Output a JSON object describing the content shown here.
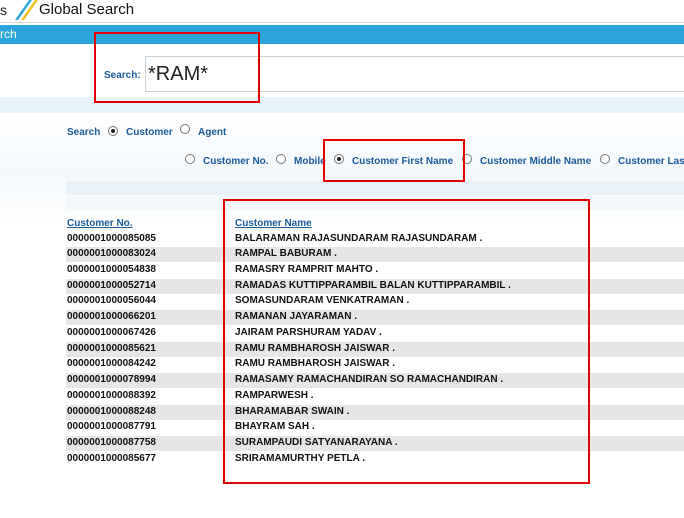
{
  "app": {
    "tab_fragment": "s",
    "title": "Global Search",
    "bar_label": "rch",
    "colors": {
      "brand_blue": "#2aa6dc",
      "label_blue": "#1a5a9a",
      "highlight_red": "#e00000"
    }
  },
  "search": {
    "label": "Search:",
    "value": "*RAM*"
  },
  "search_type": {
    "label": "Search",
    "options": [
      {
        "label": "Customer",
        "checked": true
      },
      {
        "label": "Agent",
        "checked": false
      }
    ]
  },
  "search_by": {
    "options": [
      {
        "label": "Customer No.",
        "checked": false
      },
      {
        "label": "Mobile",
        "checked": false
      },
      {
        "label": "Customer First Name",
        "checked": true
      },
      {
        "label": "Customer Middle Name",
        "checked": false
      },
      {
        "label": "Customer Las",
        "checked": false
      }
    ]
  },
  "results": {
    "headers": {
      "customer_no": "Customer No.",
      "customer_name": "Customer Name"
    },
    "rows": [
      {
        "no": "0000001000085085",
        "name": "BALARAMAN RAJASUNDARAM RAJASUNDARAM  ."
      },
      {
        "no": "0000001000083024",
        "name": "RAMPAL BABURAM   ."
      },
      {
        "no": "0000001000054838",
        "name": "RAMASRY RAMPRIT MAHTO  ."
      },
      {
        "no": "0000001000052714",
        "name": "RAMADAS KUTTIPPARAMBIL BALAN KUTTIPPARAMBIL  ."
      },
      {
        "no": "0000001000056044",
        "name": "SOMASUNDARAM VENKATRAMAN   ."
      },
      {
        "no": "0000001000066201",
        "name": "RAMANAN JAYARAMAN   ."
      },
      {
        "no": "0000001000067426",
        "name": "JAIRAM PARSHURAM YADAV  ."
      },
      {
        "no": "0000001000085621",
        "name": "RAMU RAMBHAROSH JAISWAR  ."
      },
      {
        "no": "0000001000084242",
        "name": "RAMU RAMBHAROSH JAISWAR  ."
      },
      {
        "no": "0000001000078994",
        "name": "RAMASAMY RAMACHANDIRAN SO RAMACHANDIRAN  ."
      },
      {
        "no": "0000001000088392",
        "name": "RAMPARWESH   ."
      },
      {
        "no": "0000001000088248",
        "name": "BHARAMABAR SWAIN  ."
      },
      {
        "no": "0000001000087791",
        "name": "BHAYRAM SAH  ."
      },
      {
        "no": "0000001000087758",
        "name": "SURAMPAUDI SATYANARAYANA  ."
      },
      {
        "no": "0000001000085677",
        "name": "SRIRAMAMURTHY PETLA  ."
      }
    ]
  }
}
